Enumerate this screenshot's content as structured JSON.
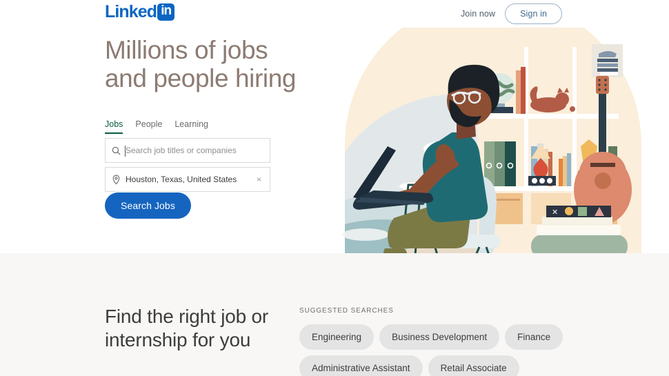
{
  "header": {
    "logo_text": "Linked",
    "logo_badge": "in",
    "join_now": "Join now",
    "sign_in": "Sign in"
  },
  "hero": {
    "title": "Millions of jobs and people hiring",
    "tabs": [
      {
        "label": "Jobs",
        "active": true
      },
      {
        "label": "People",
        "active": false
      },
      {
        "label": "Learning",
        "active": false
      }
    ],
    "search": {
      "keyword_placeholder": "Search job titles or companies",
      "keyword_value": "",
      "location_value": "Houston, Texas, United States",
      "clear_label": "×",
      "search_icon": "search-icon",
      "location_icon": "location-pin-icon"
    },
    "search_button": "Search Jobs"
  },
  "illustration": {
    "alt": "person-with-laptop-at-bookshelf",
    "elements": [
      "laptop",
      "person",
      "chair",
      "bookshelf",
      "globe",
      "cat",
      "guitar",
      "lamp",
      "binders",
      "framed-picture",
      "ottoman",
      "books",
      "window-landscape"
    ]
  },
  "lower": {
    "title": "Find the right job or internship for you",
    "suggested_label": "Suggested searches",
    "chips": [
      "Engineering",
      "Business Development",
      "Finance",
      "Administrative Assistant",
      "Retail Associate"
    ]
  },
  "colors": {
    "brand_blue": "#0a66c2",
    "button_blue": "#1565c0",
    "tab_active_green": "#0a5c3e",
    "hero_title": "#8c7b72",
    "lower_bg": "#f8f7f5",
    "chip_bg": "#e4e4e4"
  }
}
